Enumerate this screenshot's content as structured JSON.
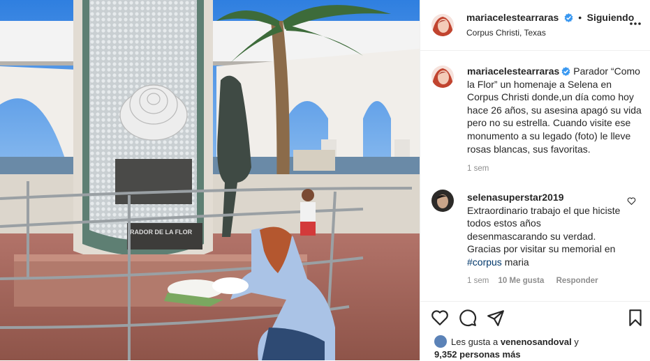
{
  "post": {
    "username": "mariacelestearraras",
    "separator": "•",
    "follow_label": "Siguiendo",
    "location": "Corpus Christi, Texas",
    "more_icon": "more-horizontal-icon"
  },
  "caption": {
    "username": "mariacelestearraras",
    "text": "Parador “Como la Flor” un homenaje a Selena en Corpus Christi donde,un día como hoy hace 26 años, su asesina apagó su vida pero no su estrella. Cuando visite ese monumento a su legado (foto) le lleve rosas blancas, sus favoritas.",
    "time": "1 sem"
  },
  "comment": {
    "username": "selenasuperstar2019",
    "text_before": "Extraordinario trabajo el que hiciste todos estos años desenmascarando su verdad. Gracias por visitar su memorial en ",
    "hashtag": "#corpus",
    "text_after": " maria",
    "time": "1 sem",
    "likes": "10 Me gusta",
    "reply_label": "Responder"
  },
  "photo": {
    "plaque_text": "RADOR DE LA FLOR"
  },
  "actions": {
    "like_icon": "heart-icon",
    "comment_icon": "comment-icon",
    "share_icon": "send-icon",
    "save_icon": "bookmark-icon"
  },
  "likes": {
    "prefix": "Les gusta a ",
    "user": "venenosandoval",
    "conj": " y",
    "count": "9,352 personas más"
  },
  "colors": {
    "verified": "#3897f0",
    "hashtag": "#00376b",
    "muted": "#8e8e8e"
  }
}
